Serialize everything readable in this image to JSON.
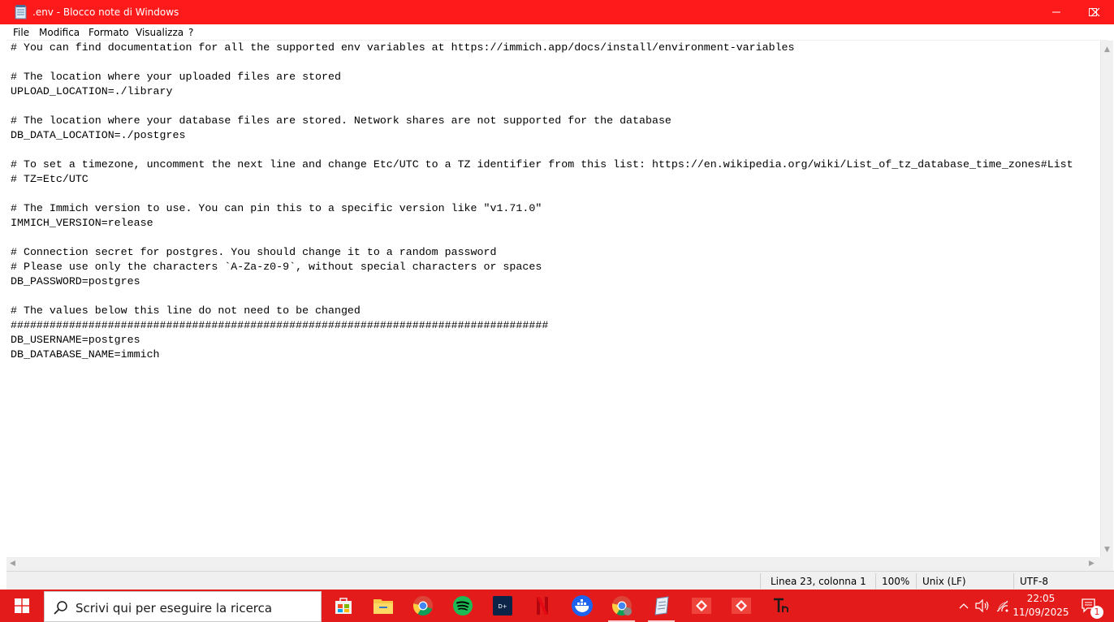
{
  "window": {
    "title": ".env - Blocco note di Windows",
    "accent_color": "#fe1a1a"
  },
  "menu": [
    "File",
    "Modifica",
    "Formato",
    "Visualizza",
    "?"
  ],
  "editor": {
    "lines": [
      "# You can find documentation for all the supported env variables at https://immich.app/docs/install/environment-variables",
      "",
      "# The location where your uploaded files are stored",
      "UPLOAD_LOCATION=./library",
      "",
      "# The location where your database files are stored. Network shares are not supported for the database",
      "DB_DATA_LOCATION=./postgres",
      "",
      "# To set a timezone, uncomment the next line and change Etc/UTC to a TZ identifier from this list: https://en.wikipedia.org/wiki/List_of_tz_database_time_zones#List",
      "# TZ=Etc/UTC",
      "",
      "# The Immich version to use. You can pin this to a specific version like \"v1.71.0\"",
      "IMMICH_VERSION=release",
      "",
      "# Connection secret for postgres. You should change it to a random password",
      "# Please use only the characters `A-Za-z0-9`, without special characters or spaces",
      "DB_PASSWORD=postgres",
      "",
      "# The values below this line do not need to be changed",
      "###################################################################################",
      "DB_USERNAME=postgres",
      "DB_DATABASE_NAME=immich"
    ]
  },
  "status": {
    "position": "Linea 23, colonna 1",
    "zoom": "100%",
    "line_ending": "Unix (LF)",
    "encoding": "UTF-8"
  },
  "taskbar": {
    "search_placeholder": "Scrivi qui per eseguire la ricerca",
    "apps": [
      "store-icon",
      "file-explorer-icon",
      "chrome-icon",
      "spotify-icon",
      "disney-plus-icon",
      "netflix-icon",
      "docker-icon",
      "chrome-profile-icon",
      "notepad-icon",
      "anydesk-icon",
      "anydesk-icon",
      "typora-icon"
    ],
    "time": "22:05",
    "date": "11/09/2025",
    "notification_count": "1",
    "color": "#e41b1b"
  }
}
